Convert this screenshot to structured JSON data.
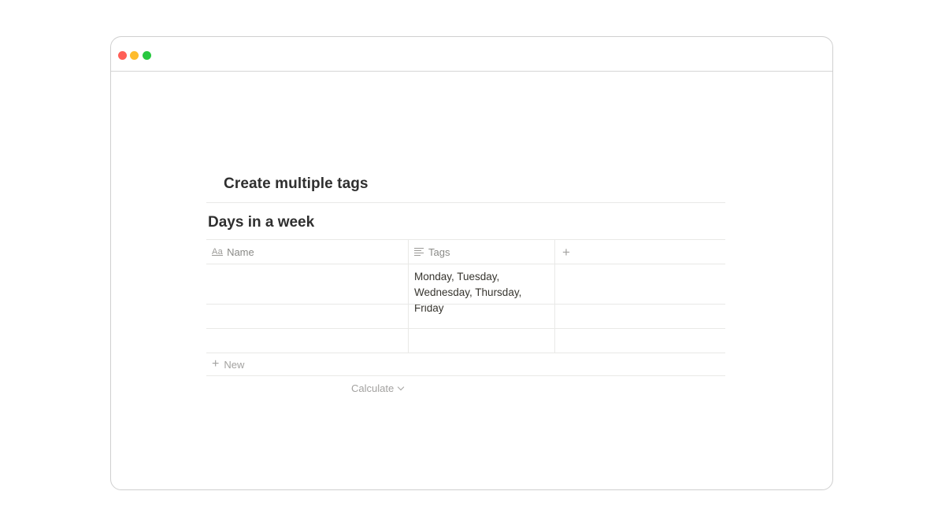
{
  "window": {
    "controls": {
      "close_color": "#ff5f57",
      "minimize_color": "#febc2e",
      "maximize_color": "#28c840"
    }
  },
  "page": {
    "title": "Create multiple tags"
  },
  "database": {
    "title": "Days in a week",
    "columns": [
      {
        "label": "Name",
        "icon": "text-aa-icon"
      },
      {
        "label": "Tags",
        "icon": "text-lines-icon"
      }
    ],
    "add_column_icon": "plus-icon",
    "rows": [
      {
        "name": "",
        "tags": "Monday, Tuesday, Wednesday, Thursday, Friday"
      },
      {
        "name": "",
        "tags": ""
      },
      {
        "name": "",
        "tags": ""
      }
    ],
    "new_label": "New",
    "calculate_label": "Calculate"
  }
}
